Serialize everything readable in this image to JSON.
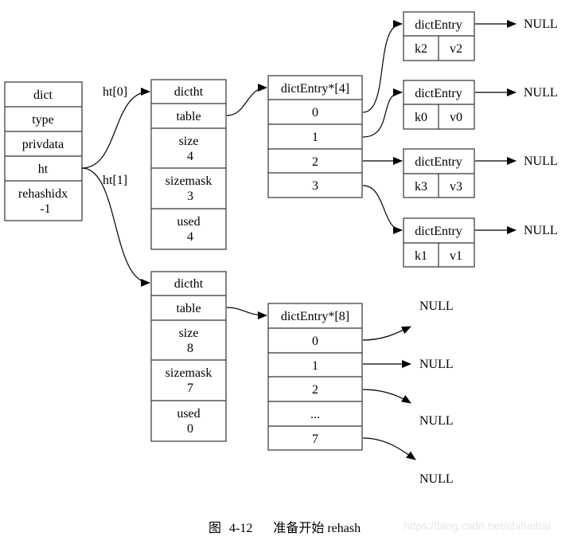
{
  "dict": {
    "title": "dict",
    "fields": [
      "type",
      "privdata",
      "ht",
      "rehashidx",
      "-1"
    ]
  },
  "edge_labels": {
    "ht0": "ht[0]",
    "ht1": "ht[1]"
  },
  "ht0": {
    "title": "dictht",
    "table": "table",
    "size_label": "size",
    "size_value": "4",
    "sizemask_label": "sizemask",
    "sizemask_value": "3",
    "used_label": "used",
    "used_value": "4"
  },
  "ht1": {
    "title": "dictht",
    "table": "table",
    "size_label": "size",
    "size_value": "8",
    "sizemask_label": "sizemask",
    "sizemask_value": "7",
    "used_label": "used",
    "used_value": "0"
  },
  "table4": {
    "title": "dictEntry*[4]",
    "slots": [
      "0",
      "1",
      "2",
      "3"
    ]
  },
  "table8": {
    "title": "dictEntry*[8]",
    "slots": [
      "0",
      "1",
      "2",
      "...",
      "7"
    ]
  },
  "entries": [
    {
      "title": "dictEntry",
      "key": "k2",
      "value": "v2",
      "next": "NULL"
    },
    {
      "title": "dictEntry",
      "key": "k0",
      "value": "v0",
      "next": "NULL"
    },
    {
      "title": "dictEntry",
      "key": "k3",
      "value": "v3",
      "next": "NULL"
    },
    {
      "title": "dictEntry",
      "key": "k1",
      "value": "v1",
      "next": "NULL"
    }
  ],
  "table8_nulls": [
    "NULL",
    "NULL",
    "NULL",
    "NULL"
  ],
  "caption": {
    "figure": "图",
    "number": "4-12",
    "text": "准备开始 rehash"
  },
  "watermark": "https://blog.csdn.net/chihaihai"
}
